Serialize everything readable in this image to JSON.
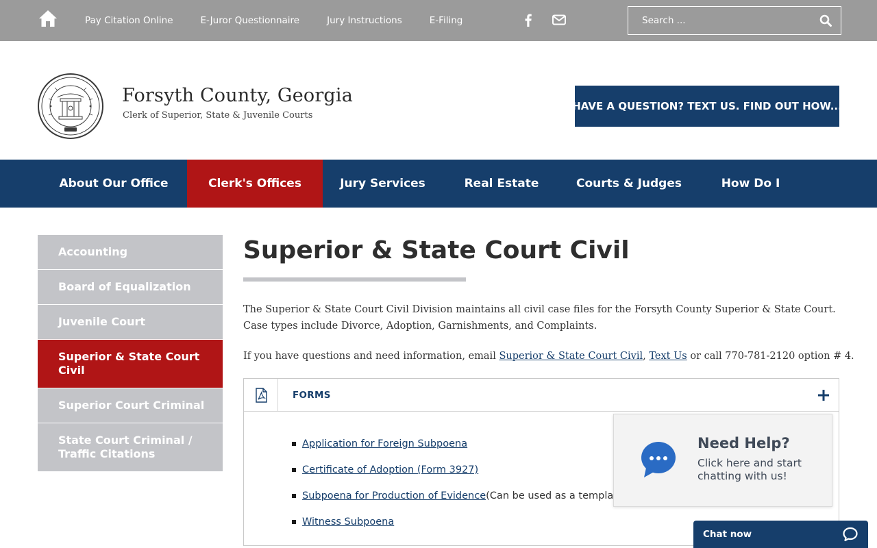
{
  "topbar": {
    "home_icon": "home-icon",
    "links": [
      "Pay Citation Online",
      "E-Juror Questionnaire",
      "Jury Instructions",
      "E-Filing"
    ],
    "social": [
      "facebook-icon",
      "envelope-icon"
    ],
    "search_placeholder": "Search ...",
    "search_icon": "magnifier-icon"
  },
  "header": {
    "seal_icon": "state-seal-icon",
    "title": "Forsyth County, Georgia",
    "subtitle": "Clerk of Superior, State & Juvenile Courts",
    "cta": "HAVE A QUESTION? TEXT US. FIND OUT HOW..."
  },
  "nav": {
    "items": [
      "About Our Office",
      "Clerk's Offices",
      "Jury Services",
      "Real Estate",
      "Courts & Judges",
      "How Do I"
    ],
    "active": "Clerk's Offices"
  },
  "sidebar": {
    "items": [
      "Accounting",
      "Board of Equalization",
      "Juvenile Court",
      "Superior & State Court Civil",
      "Superior Court Criminal",
      "State Court Criminal / Traffic Citations"
    ],
    "active": "Superior & State Court Civil"
  },
  "content": {
    "title": "Superior & State Court Civil",
    "intro": "The Superior & State Court Civil Division maintains all civil case files for the Forsyth County Superior & State Court. Case types include Divorce, Adoption, Garnishments, and Complaints.",
    "contact_prefix": "If you have questions and need information, email ",
    "contact_link1": "Superior & State Court Civil",
    "contact_sep": ", ",
    "contact_link2": "Text Us",
    "contact_suffix": " or call 770-781-2120 option # 4.",
    "panel": {
      "label": "FORMS",
      "icon": "pdf-icon",
      "toggle_icon": "plus-icon",
      "forms": [
        {
          "link": "Application for Foreign Subpoena",
          "note": ""
        },
        {
          "link": "Certificate of Adoption (Form 3927)",
          "note": ""
        },
        {
          "link": "Subpoena for Production of Evidence",
          "note": " (Can be used as a template"
        },
        {
          "link": "Witness Subpoena",
          "note": ""
        }
      ]
    }
  },
  "chat": {
    "help_title": "Need Help?",
    "help_text": "Click here and start chatting with us!",
    "bar_label": "Chat now",
    "chat_icon": "chat-bubble-icon"
  },
  "colors": {
    "topbar_bg": "#9b9b9b",
    "navy": "#163e6b",
    "active_red": "#b01516",
    "sidebar_grey": "#c3c4c8"
  }
}
